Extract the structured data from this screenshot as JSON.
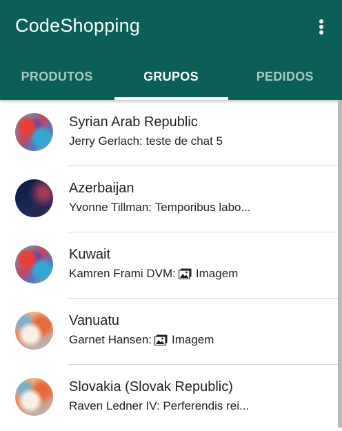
{
  "app": {
    "title": "CodeShopping",
    "menu_icon": "more-vert-icon"
  },
  "tabs": [
    {
      "label": "PRODUTOS",
      "active": false
    },
    {
      "label": "GRUPOS",
      "active": true
    },
    {
      "label": "PEDIDOS",
      "active": false
    }
  ],
  "groups": [
    {
      "name": "Syrian Arab Republic",
      "sender": "Jerry Gerlach:",
      "message": "teste de chat 5"
    },
    {
      "name": "Azerbaijan",
      "sender": "Yvonne Tillman:",
      "message": "Temporibus labo..."
    },
    {
      "name": "Kuwait",
      "sender": "Kamren Frami DVM:",
      "message": "Imagem",
      "icon": "image-icon"
    },
    {
      "name": "Vanuatu",
      "sender": "Garnet Hansen:",
      "message": "Imagem",
      "icon": "image-icon"
    },
    {
      "name": "Slovakia (Slovak Republic)",
      "sender": "Raven Ledner IV:",
      "message": "Perferendis rei..."
    }
  ],
  "colors": {
    "primary": "#0b5f58",
    "tab_active": "#ffffff",
    "tab_inactive": "#a9c7c4"
  }
}
